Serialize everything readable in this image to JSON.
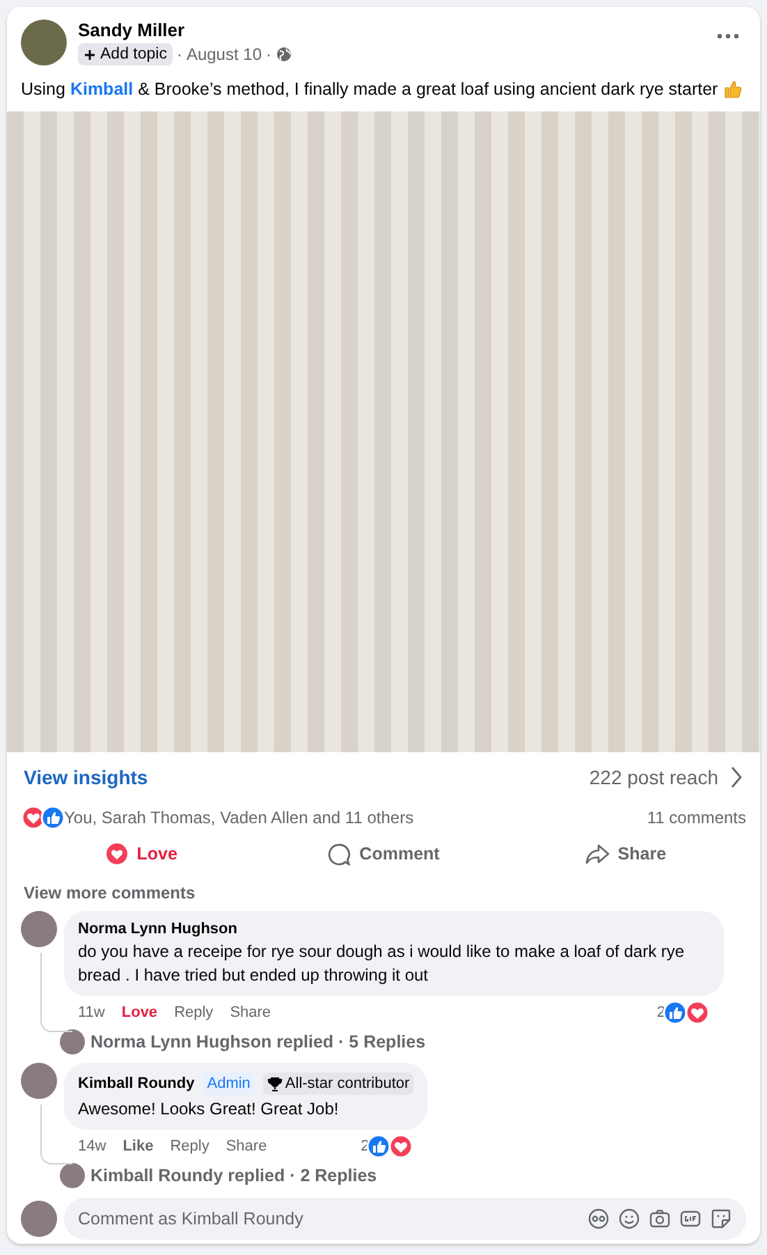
{
  "post": {
    "author": "Sandy Miller",
    "topic_button": "Add topic",
    "meta_separators": [
      "·",
      "·"
    ],
    "date": "August 10",
    "text_parts": [
      {
        "text": "Using ",
        "kind": "plain"
      },
      {
        "text": "Kimball",
        "kind": "mention"
      },
      {
        "text": " & Brooke’s method, I finally made a great loaf using ancient dark rye starter",
        "kind": "plain"
      }
    ]
  },
  "insights": {
    "link": "View insights",
    "reach": "222 post reach"
  },
  "reactions": {
    "summary": "You, Sarah Thomas, Vaden Allen and 11 others",
    "comments": "11 comments"
  },
  "actions": [
    {
      "label": "Love",
      "kind": "love",
      "selected": true
    },
    {
      "label": "Comment",
      "kind": "comment",
      "selected": false
    },
    {
      "label": "Share",
      "kind": "share",
      "selected": false
    }
  ],
  "view_more": "View more comments",
  "comments": [
    {
      "author": "Norma Lynn Hughson",
      "text": "do you have a receipe for rye sour dough as i would like to make a loaf of dark rye bread . I have tried but ended up throwing it out",
      "time": "11w",
      "reaction": {
        "label": "Love",
        "kind": "love"
      },
      "reply": "Reply",
      "share": "Share",
      "count": "2",
      "replies": "Norma Lynn Hughson replied · 5 Replies"
    },
    {
      "author": "Kimball Roundy",
      "badges": [
        {
          "label": "Admin",
          "kind": "role"
        },
        {
          "label": "All-star contributor",
          "kind": "award"
        }
      ],
      "text": "Awesome! Looks Great! Great Job!",
      "time": "14w",
      "reaction": {
        "label": "Like",
        "kind": "none"
      },
      "reply": "Reply",
      "share": "Share",
      "count": "2",
      "replies": "Kimball Roundy replied · 2 Replies"
    }
  ],
  "composer": {
    "placeholder": "Comment as Kimball Roundy"
  }
}
